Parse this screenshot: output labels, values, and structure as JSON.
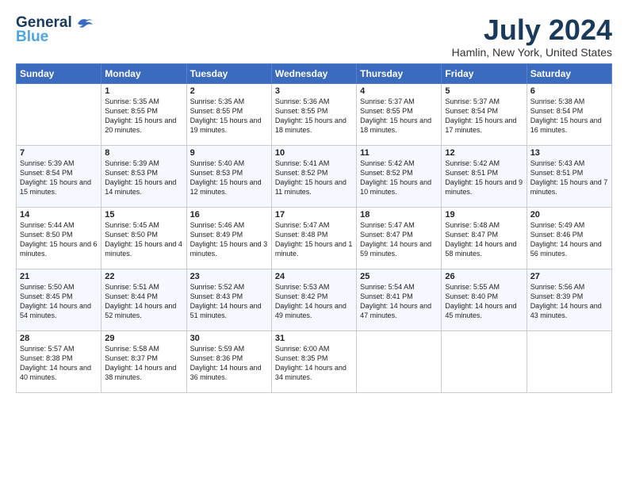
{
  "header": {
    "logo_general": "General",
    "logo_blue": "Blue",
    "title": "July 2024",
    "subtitle": "Hamlin, New York, United States"
  },
  "days_of_week": [
    "Sunday",
    "Monday",
    "Tuesday",
    "Wednesday",
    "Thursday",
    "Friday",
    "Saturday"
  ],
  "weeks": [
    [
      {
        "day": "",
        "content": ""
      },
      {
        "day": "1",
        "content": "Sunrise: 5:35 AM\nSunset: 8:55 PM\nDaylight: 15 hours\nand 20 minutes."
      },
      {
        "day": "2",
        "content": "Sunrise: 5:35 AM\nSunset: 8:55 PM\nDaylight: 15 hours\nand 19 minutes."
      },
      {
        "day": "3",
        "content": "Sunrise: 5:36 AM\nSunset: 8:55 PM\nDaylight: 15 hours\nand 18 minutes."
      },
      {
        "day": "4",
        "content": "Sunrise: 5:37 AM\nSunset: 8:55 PM\nDaylight: 15 hours\nand 18 minutes."
      },
      {
        "day": "5",
        "content": "Sunrise: 5:37 AM\nSunset: 8:54 PM\nDaylight: 15 hours\nand 17 minutes."
      },
      {
        "day": "6",
        "content": "Sunrise: 5:38 AM\nSunset: 8:54 PM\nDaylight: 15 hours\nand 16 minutes."
      }
    ],
    [
      {
        "day": "7",
        "content": "Sunrise: 5:39 AM\nSunset: 8:54 PM\nDaylight: 15 hours\nand 15 minutes."
      },
      {
        "day": "8",
        "content": "Sunrise: 5:39 AM\nSunset: 8:53 PM\nDaylight: 15 hours\nand 14 minutes."
      },
      {
        "day": "9",
        "content": "Sunrise: 5:40 AM\nSunset: 8:53 PM\nDaylight: 15 hours\nand 12 minutes."
      },
      {
        "day": "10",
        "content": "Sunrise: 5:41 AM\nSunset: 8:52 PM\nDaylight: 15 hours\nand 11 minutes."
      },
      {
        "day": "11",
        "content": "Sunrise: 5:42 AM\nSunset: 8:52 PM\nDaylight: 15 hours\nand 10 minutes."
      },
      {
        "day": "12",
        "content": "Sunrise: 5:42 AM\nSunset: 8:51 PM\nDaylight: 15 hours\nand 9 minutes."
      },
      {
        "day": "13",
        "content": "Sunrise: 5:43 AM\nSunset: 8:51 PM\nDaylight: 15 hours\nand 7 minutes."
      }
    ],
    [
      {
        "day": "14",
        "content": "Sunrise: 5:44 AM\nSunset: 8:50 PM\nDaylight: 15 hours\nand 6 minutes."
      },
      {
        "day": "15",
        "content": "Sunrise: 5:45 AM\nSunset: 8:50 PM\nDaylight: 15 hours\nand 4 minutes."
      },
      {
        "day": "16",
        "content": "Sunrise: 5:46 AM\nSunset: 8:49 PM\nDaylight: 15 hours\nand 3 minutes."
      },
      {
        "day": "17",
        "content": "Sunrise: 5:47 AM\nSunset: 8:48 PM\nDaylight: 15 hours\nand 1 minute."
      },
      {
        "day": "18",
        "content": "Sunrise: 5:47 AM\nSunset: 8:47 PM\nDaylight: 14 hours\nand 59 minutes."
      },
      {
        "day": "19",
        "content": "Sunrise: 5:48 AM\nSunset: 8:47 PM\nDaylight: 14 hours\nand 58 minutes."
      },
      {
        "day": "20",
        "content": "Sunrise: 5:49 AM\nSunset: 8:46 PM\nDaylight: 14 hours\nand 56 minutes."
      }
    ],
    [
      {
        "day": "21",
        "content": "Sunrise: 5:50 AM\nSunset: 8:45 PM\nDaylight: 14 hours\nand 54 minutes."
      },
      {
        "day": "22",
        "content": "Sunrise: 5:51 AM\nSunset: 8:44 PM\nDaylight: 14 hours\nand 52 minutes."
      },
      {
        "day": "23",
        "content": "Sunrise: 5:52 AM\nSunset: 8:43 PM\nDaylight: 14 hours\nand 51 minutes."
      },
      {
        "day": "24",
        "content": "Sunrise: 5:53 AM\nSunset: 8:42 PM\nDaylight: 14 hours\nand 49 minutes."
      },
      {
        "day": "25",
        "content": "Sunrise: 5:54 AM\nSunset: 8:41 PM\nDaylight: 14 hours\nand 47 minutes."
      },
      {
        "day": "26",
        "content": "Sunrise: 5:55 AM\nSunset: 8:40 PM\nDaylight: 14 hours\nand 45 minutes."
      },
      {
        "day": "27",
        "content": "Sunrise: 5:56 AM\nSunset: 8:39 PM\nDaylight: 14 hours\nand 43 minutes."
      }
    ],
    [
      {
        "day": "28",
        "content": "Sunrise: 5:57 AM\nSunset: 8:38 PM\nDaylight: 14 hours\nand 40 minutes."
      },
      {
        "day": "29",
        "content": "Sunrise: 5:58 AM\nSunset: 8:37 PM\nDaylight: 14 hours\nand 38 minutes."
      },
      {
        "day": "30",
        "content": "Sunrise: 5:59 AM\nSunset: 8:36 PM\nDaylight: 14 hours\nand 36 minutes."
      },
      {
        "day": "31",
        "content": "Sunrise: 6:00 AM\nSunset: 8:35 PM\nDaylight: 14 hours\nand 34 minutes."
      },
      {
        "day": "",
        "content": ""
      },
      {
        "day": "",
        "content": ""
      },
      {
        "day": "",
        "content": ""
      }
    ]
  ]
}
